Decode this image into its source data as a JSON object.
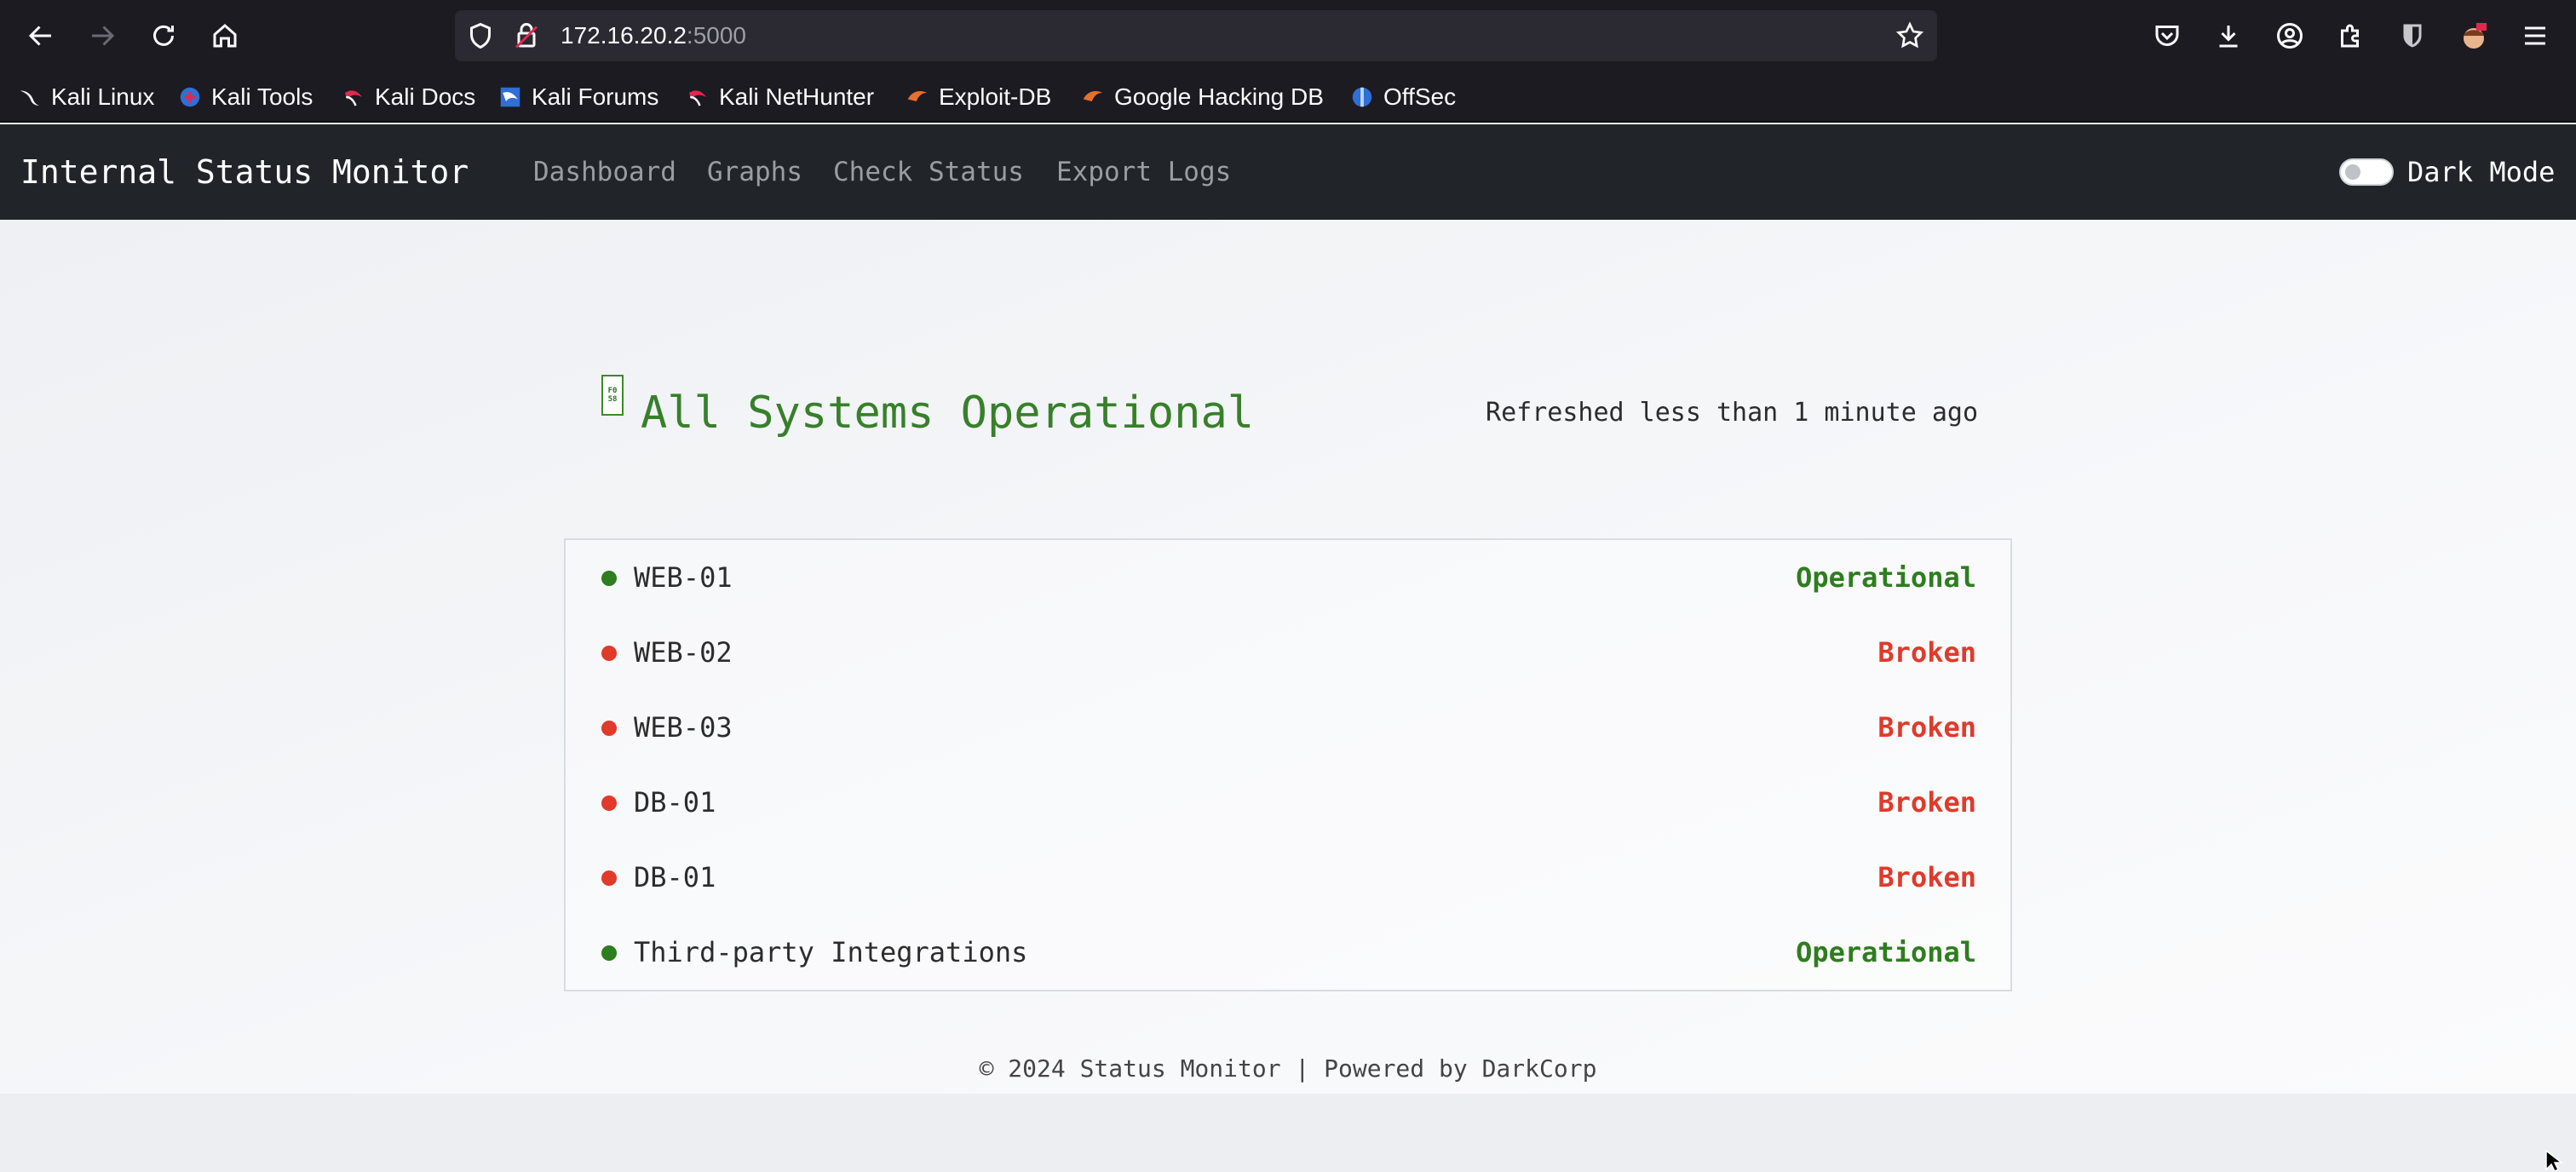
{
  "browser": {
    "url_host": "172.16.20.2",
    "url_port": ":5000",
    "bookmarks": [
      {
        "label": "Kali Linux",
        "icon": "kali-dragon-icon"
      },
      {
        "label": "Kali Tools",
        "icon": "kali-tools-icon"
      },
      {
        "label": "Kali Docs",
        "icon": "kali-docs-icon"
      },
      {
        "label": "Kali Forums",
        "icon": "kali-forums-icon"
      },
      {
        "label": "Kali NetHunter",
        "icon": "kali-nethunter-icon"
      },
      {
        "label": "Exploit-DB",
        "icon": "exploit-db-icon"
      },
      {
        "label": "Google Hacking DB",
        "icon": "ghdb-icon"
      },
      {
        "label": "OffSec",
        "icon": "offsec-icon"
      }
    ]
  },
  "navbar": {
    "brand": "Internal Status Monitor",
    "links": [
      "Dashboard",
      "Graphs",
      "Check Status",
      "Export Logs"
    ],
    "dark_mode_label": "Dark Mode"
  },
  "status": {
    "icon_glyph_top": "F0",
    "icon_glyph_bottom": "58",
    "headline": "All Systems Operational",
    "refreshed": "Refreshed less than 1 minute ago"
  },
  "services": [
    {
      "name": "WEB-01",
      "state": "Operational"
    },
    {
      "name": "WEB-02",
      "state": "Broken"
    },
    {
      "name": "WEB-03",
      "state": "Broken"
    },
    {
      "name": "DB-01",
      "state": "Broken"
    },
    {
      "name": "DB-01",
      "state": "Broken"
    },
    {
      "name": "Third-party Integrations",
      "state": "Operational"
    }
  ],
  "colors": {
    "operational": "#2e7d1f",
    "broken": "#e03a2b",
    "navbar_bg": "#212529",
    "chrome_bg": "#1c1b22"
  },
  "footer": "© 2024 Status Monitor | Powered by DarkCorp"
}
